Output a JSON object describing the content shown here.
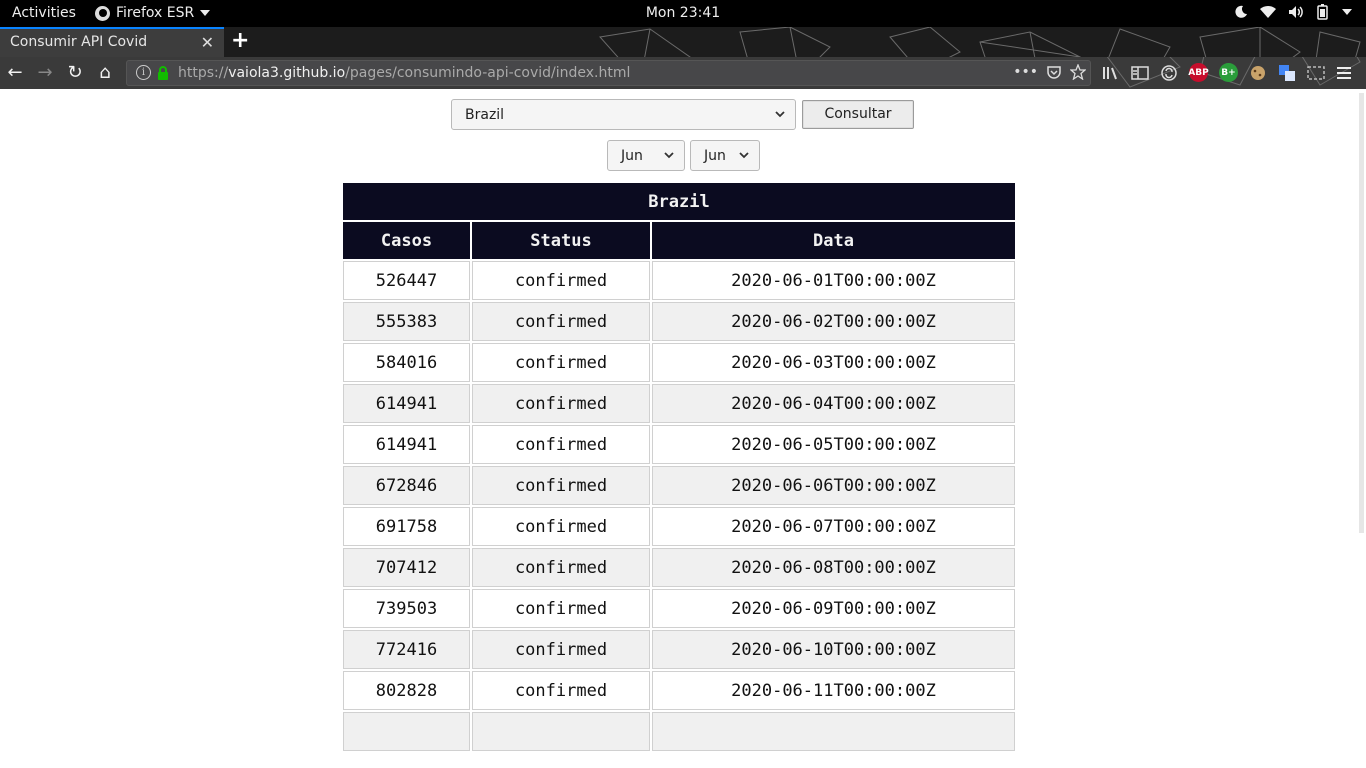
{
  "system_bar": {
    "activities": "Activities",
    "app_name": "Firefox ESR",
    "clock": "Mon 23:41"
  },
  "browser": {
    "tab_title": "Consumir API Covid",
    "url_prefix": "https://",
    "url_host": "vaiola3.github.io",
    "url_path": "/pages/consumindo-api-covid/index.html",
    "accent_color": "#0a84ff"
  },
  "form": {
    "country_selected": "Brazil",
    "consult_label": "Consultar",
    "month_from": "Jun",
    "month_to": "Jun"
  },
  "table": {
    "caption": "Brazil",
    "headers": [
      "Casos",
      "Status",
      "Data"
    ],
    "rows": [
      [
        "526447",
        "confirmed",
        "2020-06-01T00:00:00Z"
      ],
      [
        "555383",
        "confirmed",
        "2020-06-02T00:00:00Z"
      ],
      [
        "584016",
        "confirmed",
        "2020-06-03T00:00:00Z"
      ],
      [
        "614941",
        "confirmed",
        "2020-06-04T00:00:00Z"
      ],
      [
        "614941",
        "confirmed",
        "2020-06-05T00:00:00Z"
      ],
      [
        "672846",
        "confirmed",
        "2020-06-06T00:00:00Z"
      ],
      [
        "691758",
        "confirmed",
        "2020-06-07T00:00:00Z"
      ],
      [
        "707412",
        "confirmed",
        "2020-06-08T00:00:00Z"
      ],
      [
        "739503",
        "confirmed",
        "2020-06-09T00:00:00Z"
      ],
      [
        "772416",
        "confirmed",
        "2020-06-10T00:00:00Z"
      ],
      [
        "802828",
        "confirmed",
        "2020-06-11T00:00:00Z"
      ],
      [
        "",
        "",
        ""
      ]
    ]
  },
  "icons": {
    "system_tray": [
      "night-light-icon",
      "wifi-icon",
      "volume-icon",
      "battery-icon",
      "system-menu-icon"
    ],
    "extensions": [
      "library-icon",
      "sidebar-icon",
      "sync-icon",
      "adblock-plus-icon",
      "extension-b-icon",
      "extension-cookie-icon",
      "translate-icon",
      "screenshot-icon",
      "hamburger-menu-icon"
    ]
  }
}
